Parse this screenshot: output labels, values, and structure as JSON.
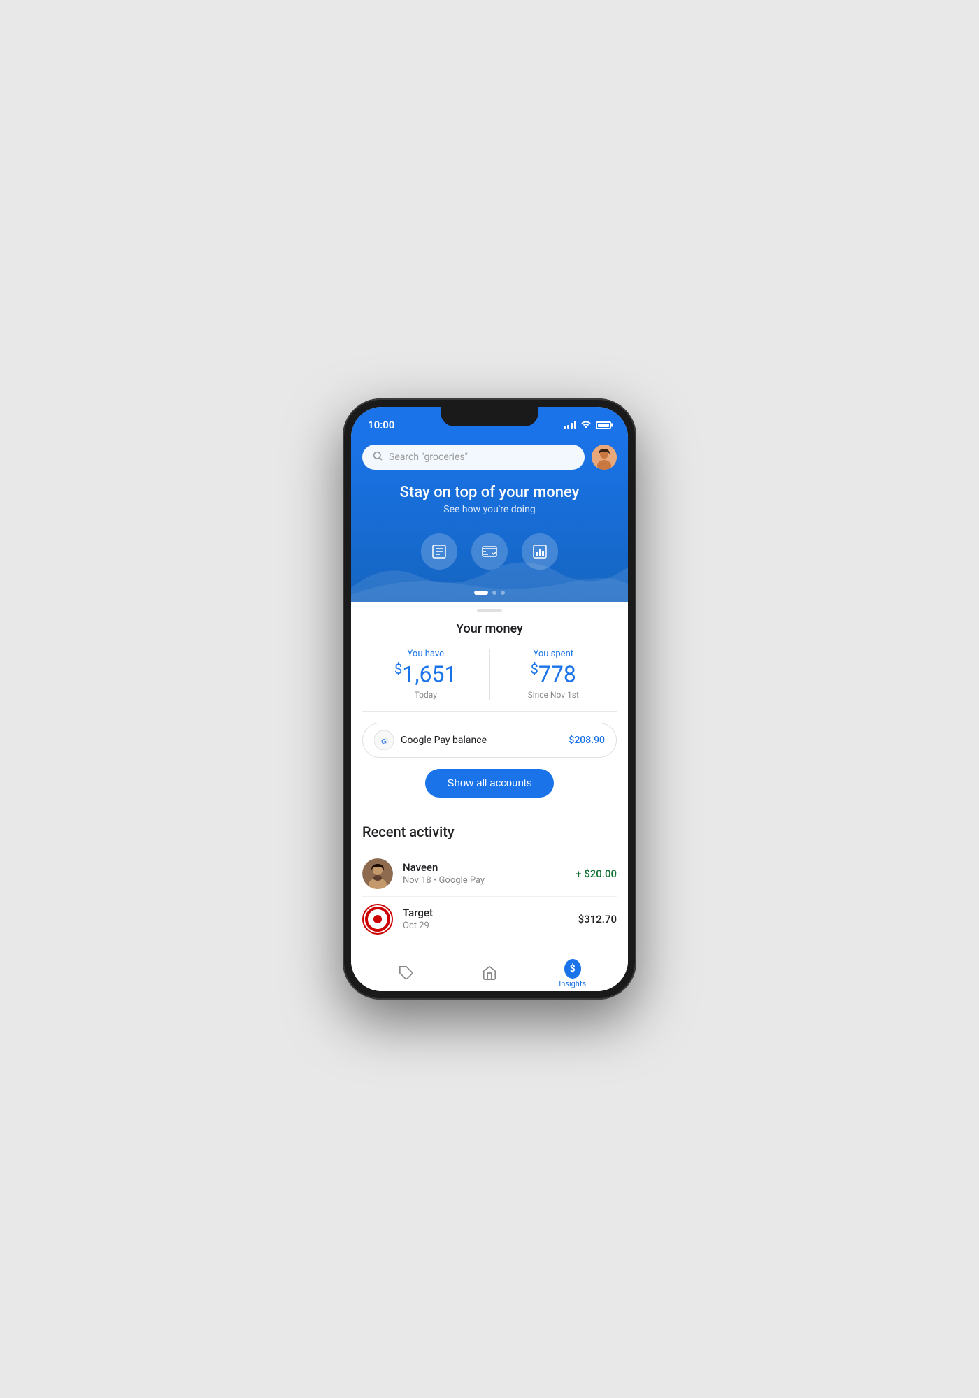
{
  "phone": {
    "status_bar": {
      "time": "10:00"
    },
    "header": {
      "search_placeholder": "Search \"groceries\"",
      "hero_title": "Stay on top of your money",
      "hero_subtitle": "See how you're doing",
      "action_icons": [
        {
          "name": "transactions-icon",
          "label": "Transactions"
        },
        {
          "name": "cards-icon",
          "label": "Cards"
        },
        {
          "name": "insights-icon",
          "label": "Insights"
        }
      ],
      "dots": [
        {
          "active": true
        },
        {
          "active": false
        },
        {
          "active": false
        }
      ]
    },
    "your_money": {
      "title": "Your money",
      "you_have": {
        "label": "You have",
        "amount_prefix": "$",
        "amount": "1,651",
        "period": "Today"
      },
      "you_spent": {
        "label": "You spent",
        "amount_prefix": "$",
        "amount": "778",
        "period": "Since Nov 1st"
      },
      "balance_row": {
        "name": "Google Pay balance",
        "amount": "$208.90"
      },
      "show_all_button": "Show all accounts"
    },
    "recent_activity": {
      "title": "Recent activity",
      "items": [
        {
          "name": "Naveen",
          "detail": "Nov 18 • Google Pay",
          "amount": "+ $20.00",
          "amount_type": "positive",
          "type": "person"
        },
        {
          "name": "Target",
          "detail": "Oct 29",
          "amount": "$312.70",
          "amount_type": "neutral",
          "type": "merchant"
        }
      ]
    },
    "bottom_nav": {
      "items": [
        {
          "label": "",
          "icon": "tag-icon",
          "active": false
        },
        {
          "label": "",
          "icon": "home-icon",
          "active": false
        },
        {
          "label": "Insights",
          "icon": "insights-nav-icon",
          "active": true
        }
      ]
    }
  }
}
